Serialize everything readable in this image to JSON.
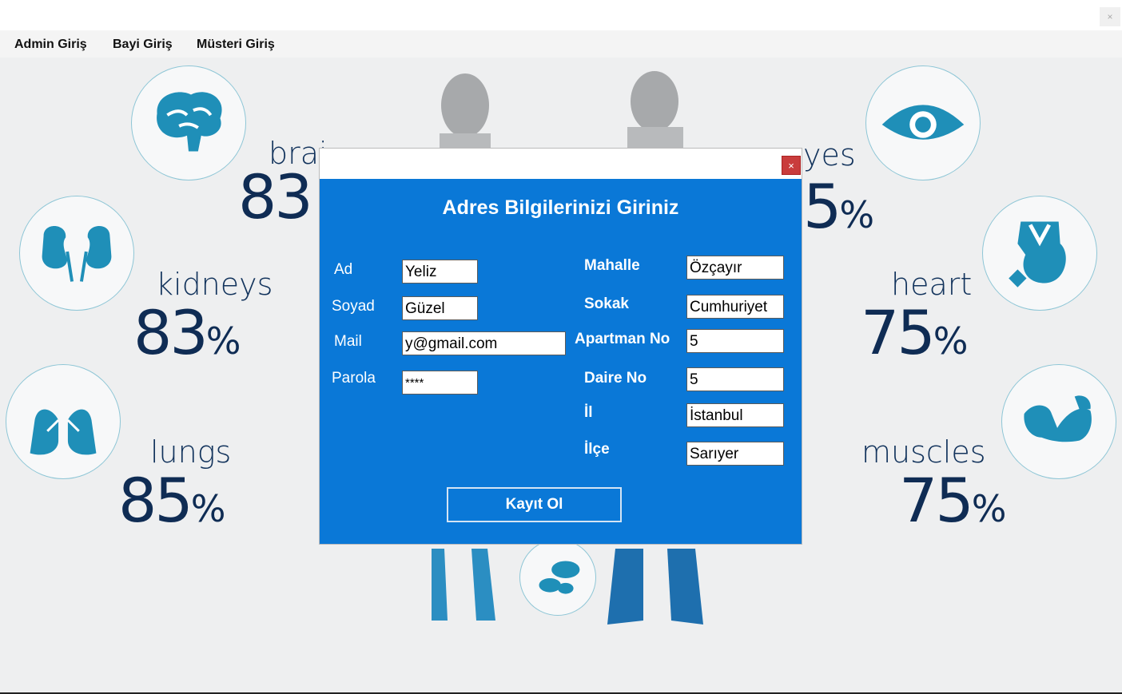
{
  "window": {
    "close_glyph": "×"
  },
  "menu": [
    {
      "label": "Admin Giriş"
    },
    {
      "label": "Bayi Giriş"
    },
    {
      "label": "Müsteri Giriş"
    }
  ],
  "background": {
    "organs": [
      {
        "name": "brain",
        "visible_name": "brai",
        "percent": "83",
        "icon": "brain-icon"
      },
      {
        "name": "eyes",
        "visible_name": "yes",
        "percent": "5",
        "icon": "eye-icon"
      },
      {
        "name": "kidneys",
        "visible_name": "kidneys",
        "percent": "83",
        "icon": "kidneys-icon"
      },
      {
        "name": "heart",
        "visible_name": "heart",
        "percent": "75",
        "icon": "heart-icon"
      },
      {
        "name": "lungs",
        "visible_name": "lungs",
        "percent": "85",
        "icon": "lungs-icon"
      },
      {
        "name": "muscles",
        "visible_name": "muscles",
        "percent": "75",
        "icon": "muscle-icon"
      }
    ],
    "percent_sign": "%"
  },
  "dialog": {
    "close_glyph": "×",
    "title": "Adres Bilgilerinizi Giriniz",
    "left_fields": [
      {
        "label": "Ad",
        "value": "Yeliz"
      },
      {
        "label": "Soyad",
        "value": "Güzel"
      },
      {
        "label": "Mail",
        "value": "y@gmail.com"
      },
      {
        "label": "Parola",
        "value": "****"
      }
    ],
    "right_fields": [
      {
        "label": "Mahalle",
        "value": "Özçayır"
      },
      {
        "label": "Sokak",
        "value": "Cumhuriyet"
      },
      {
        "label": "Apartman No",
        "value": "5"
      },
      {
        "label": "Daire No",
        "value": "5"
      },
      {
        "label": "İl",
        "value": "İstanbul"
      },
      {
        "label": "İlçe",
        "value": "Sarıyer"
      }
    ],
    "submit_label": "Kayıt Ol"
  },
  "colors": {
    "dialog_bg": "#0a78d7",
    "icon_teal": "#1f8fb8",
    "text_navy": "#12335c",
    "close_red": "#c93c3c"
  }
}
